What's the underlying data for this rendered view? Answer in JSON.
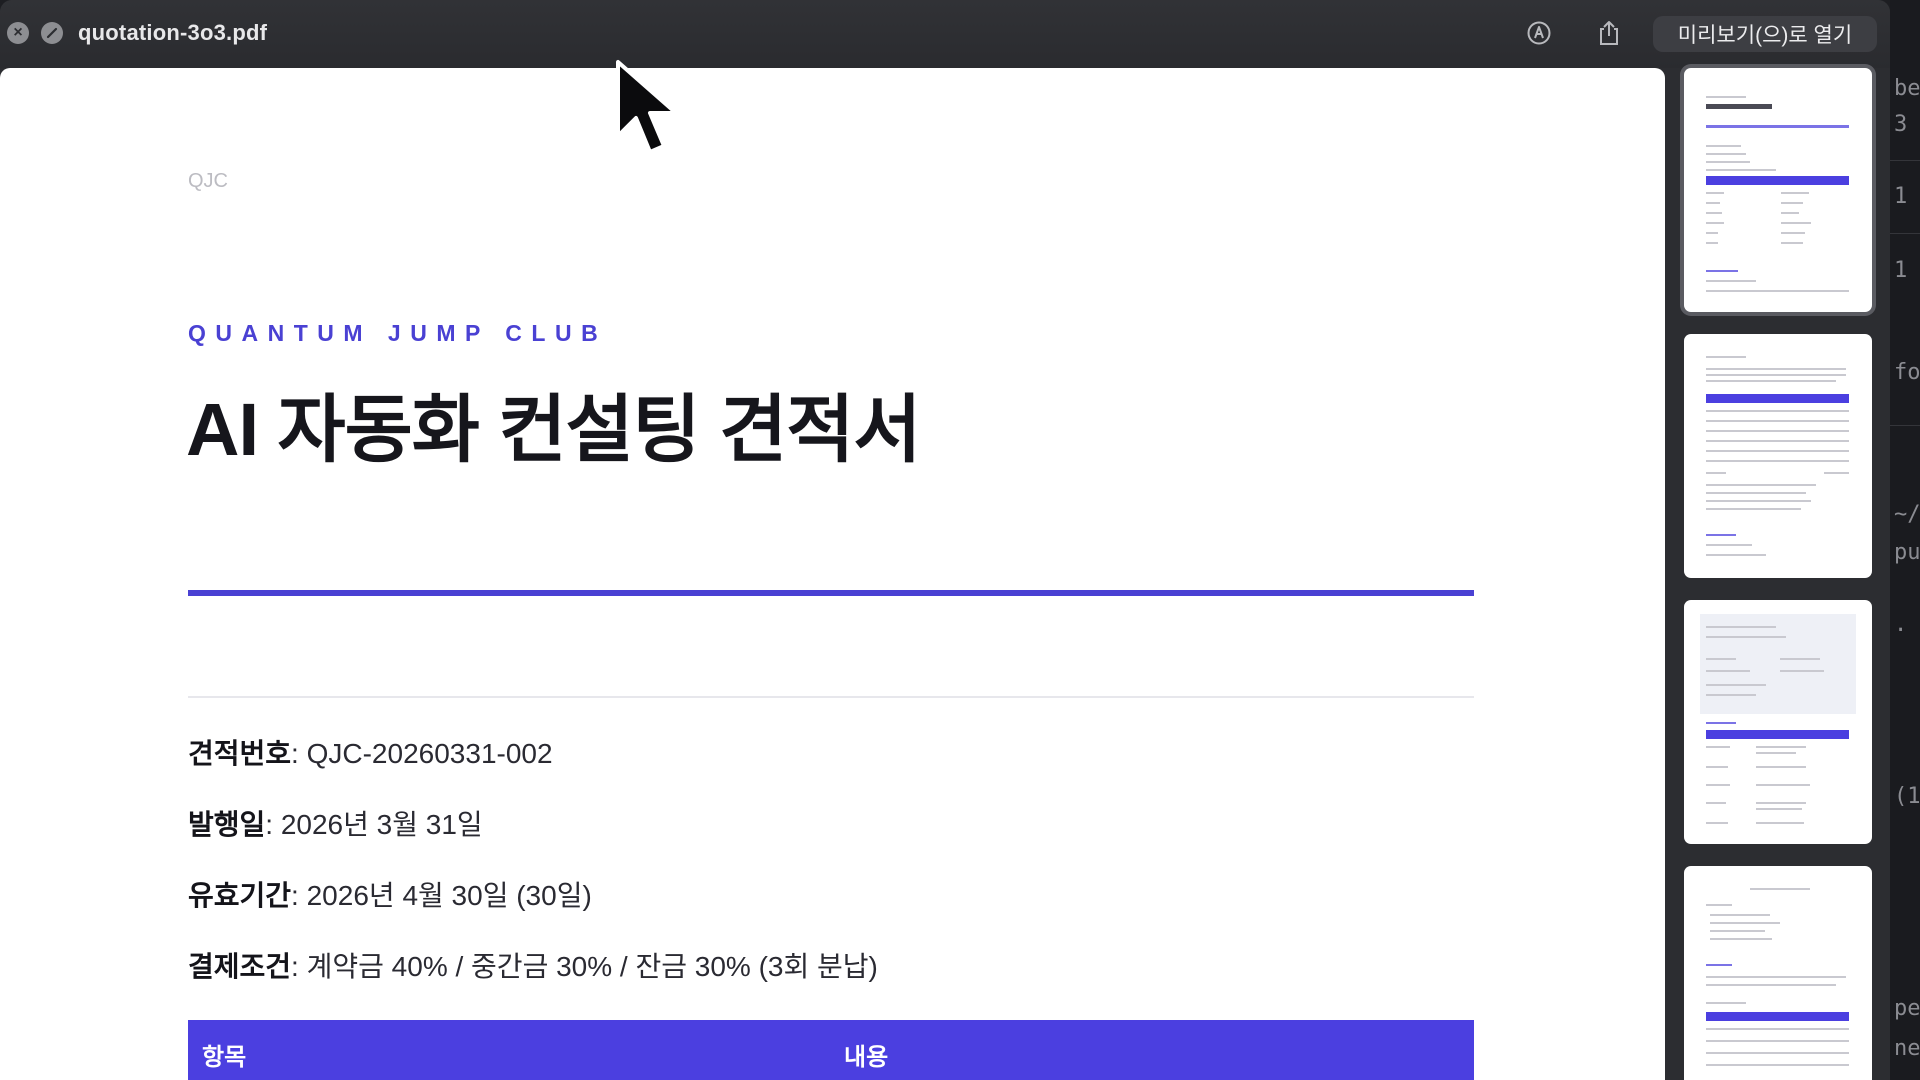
{
  "window": {
    "filename": "quotation-3o3.pdf",
    "open_with_label": "미리보기(으)로 열기",
    "icons": [
      "close-icon",
      "fullscreen-icon",
      "markup-icon",
      "share-icon"
    ]
  },
  "document": {
    "brand_small": "QJC",
    "company": "QUANTUM JUMP CLUB",
    "title": "AI 자동화 컨설팅 견적서",
    "info": {
      "quote_number": {
        "label": "견적번호",
        "value": "QJC-20260331-002"
      },
      "issue_date": {
        "label": "발행일",
        "value": "2026년 3월 31일"
      },
      "valid_until": {
        "label": "유효기간",
        "value": "2026년 4월 30일 (30일)"
      },
      "payment_terms": {
        "label": "결제조건",
        "value": "계약금 40% / 중간금 30% / 잔금 30% (3회 분납)"
      }
    },
    "table_headers": [
      "항목",
      "내용"
    ]
  },
  "sidebar": {
    "thumbnail_count": 4,
    "selected_page": 1
  },
  "background_terminal": {
    "fragments": [
      "be",
      "3",
      "1",
      "1",
      "fo",
      "~/",
      "pu",
      ".",
      "(1",
      "per",
      "ne"
    ]
  },
  "colors": {
    "accent": "#4a41d3",
    "table_header": "#4b3fe0",
    "titlebar": "#2c2d31"
  }
}
